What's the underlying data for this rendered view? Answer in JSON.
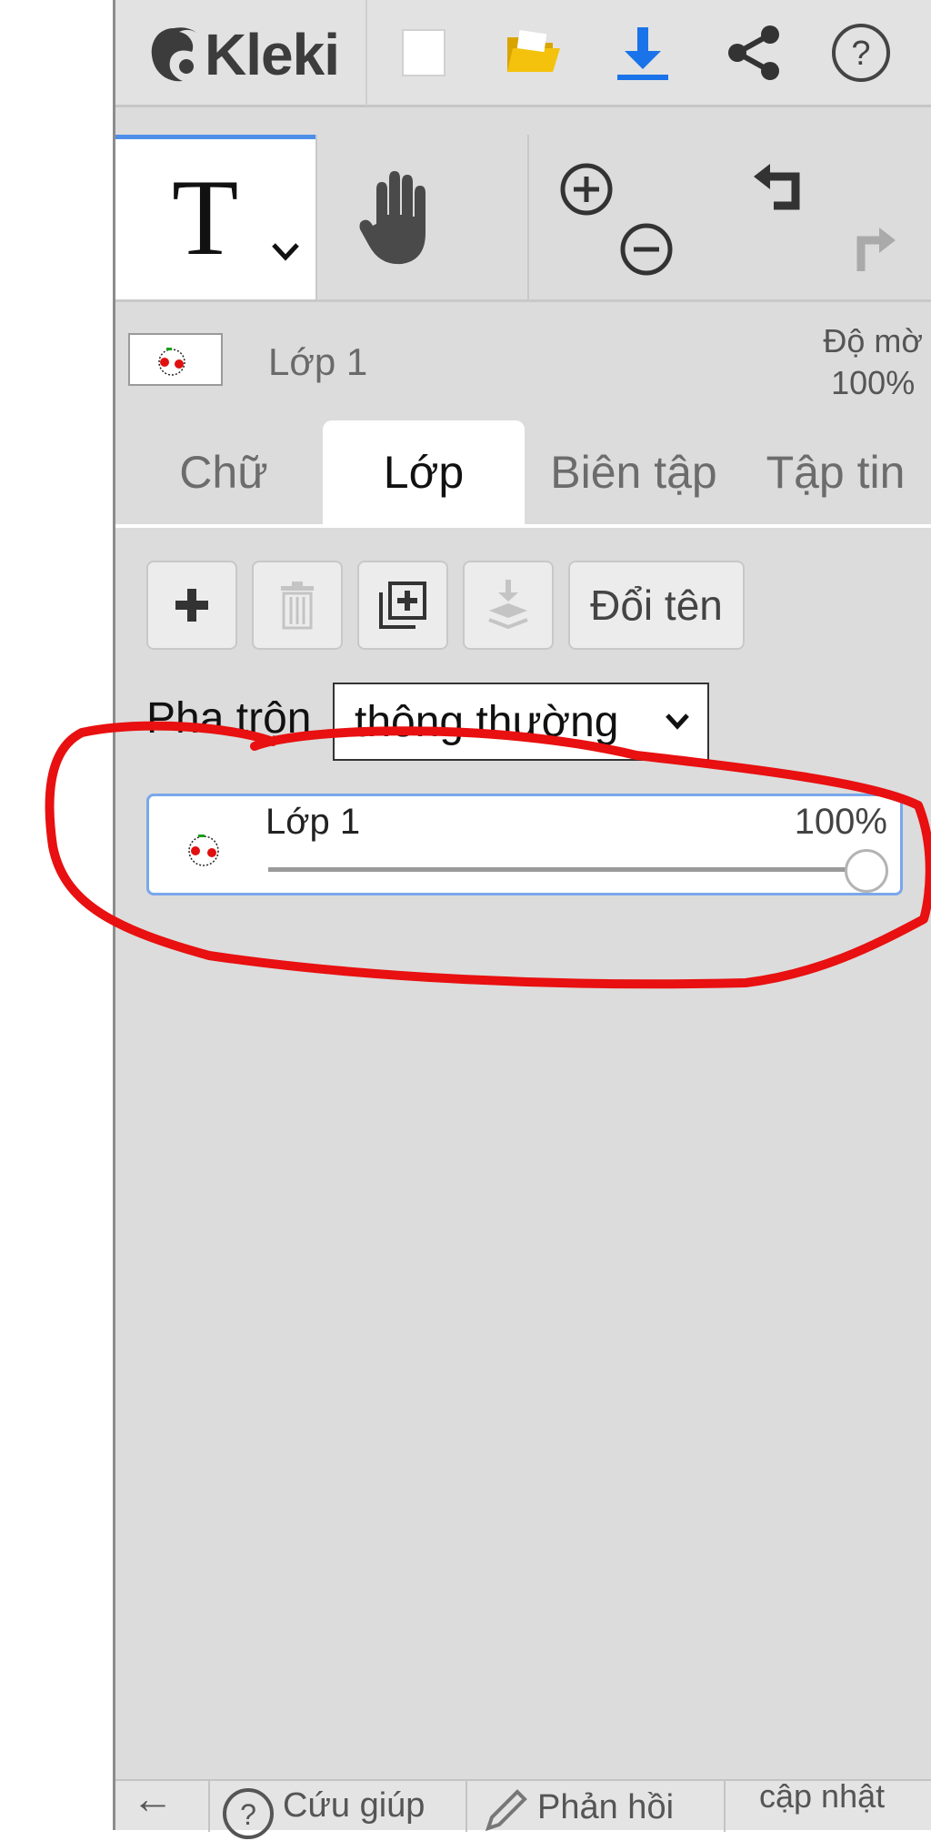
{
  "app": {
    "logo_text": "Kleki"
  },
  "topbar": {
    "buttons": [
      {
        "icon": "new-file-icon"
      },
      {
        "icon": "open-folder-icon"
      },
      {
        "icon": "download-icon"
      },
      {
        "icon": "share-icon"
      },
      {
        "icon": "help-icon"
      }
    ]
  },
  "tools": {
    "text_tool_glyph": "T",
    "active_tool": "text",
    "items": [
      "text-tool-icon",
      "hand-tool-icon",
      "zoom-icon",
      "undo-redo-icon"
    ]
  },
  "layer_info": {
    "name": "Lớp 1",
    "opacity_label": "Độ mờ",
    "opacity_value": "100%"
  },
  "tabs": [
    {
      "label": "Chữ",
      "active": false
    },
    {
      "label": "Lớp",
      "active": true
    },
    {
      "label": "Biên tập",
      "active": false
    },
    {
      "label": "Tập tin",
      "active": false
    }
  ],
  "layer_toolbar": {
    "rename_label": "Đổi tên",
    "icons": [
      "add-layer-icon",
      "delete-layer-icon",
      "duplicate-layer-icon",
      "merge-down-icon"
    ]
  },
  "blend": {
    "label": "Pha trộn",
    "selected": "thông thường"
  },
  "layers": [
    {
      "name": "Lớp 1",
      "opacity": "100%",
      "opacity_fraction": 1.0
    }
  ],
  "bottombar": {
    "back_glyph": "←",
    "help": "Cứu giúp",
    "feedback": "Phản hồi",
    "update": "cập nhật"
  },
  "colors": {
    "accent": "#4d8fe8",
    "download": "#1a73e8",
    "folder": "#f4c20d",
    "annotation": "#e81010"
  }
}
